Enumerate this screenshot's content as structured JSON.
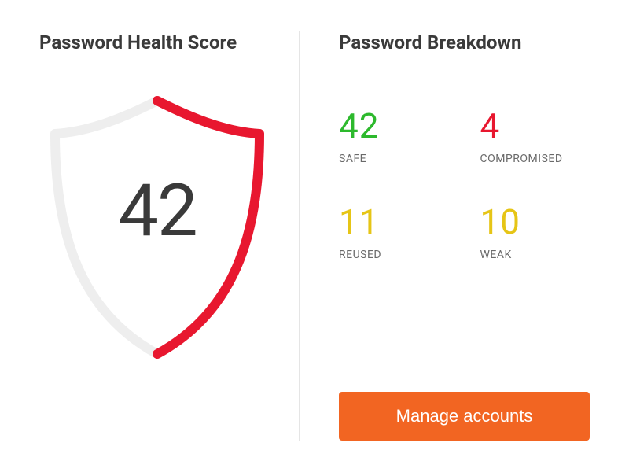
{
  "health": {
    "title": "Password Health Score",
    "score": "42"
  },
  "breakdown": {
    "title": "Password Breakdown",
    "stats": {
      "safe": {
        "value": "42",
        "label": "SAFE",
        "color": "green"
      },
      "compromised": {
        "value": "4",
        "label": "COMPROMISED",
        "color": "red"
      },
      "reused": {
        "value": "11",
        "label": "REUSED",
        "color": "yellow"
      },
      "weak": {
        "value": "10",
        "label": "WEAK",
        "color": "yellow"
      }
    },
    "manage_label": "Manage accounts"
  },
  "colors": {
    "accent_orange": "#f26522",
    "shield_fill_red": "#e8172f",
    "shield_track": "#eeeeee",
    "stat_green": "#2db92d",
    "stat_red": "#e8172f",
    "stat_yellow": "#e6c516"
  }
}
